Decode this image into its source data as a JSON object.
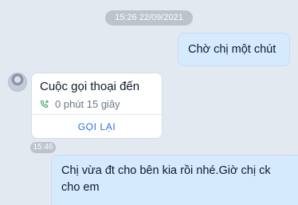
{
  "date_badge": "15:26 22/09/2021",
  "messages": {
    "outgoing_1": "Chờ chị một chút",
    "call": {
      "title": "Cuộc gọi thoại đến",
      "duration": "0 phút 15 giây",
      "action": "GỌI LẠI",
      "icon": "phone-icon",
      "accent_color": "#2a6fe0"
    },
    "time_badge": "15:46",
    "outgoing_2": "Chị vừa đt cho bên kia rồi nhé.Giờ chị ck cho em"
  },
  "colors": {
    "background": "#e2e9f1",
    "outgoing_bubble": "#d6eafe",
    "badge": "#bcc3cc"
  }
}
